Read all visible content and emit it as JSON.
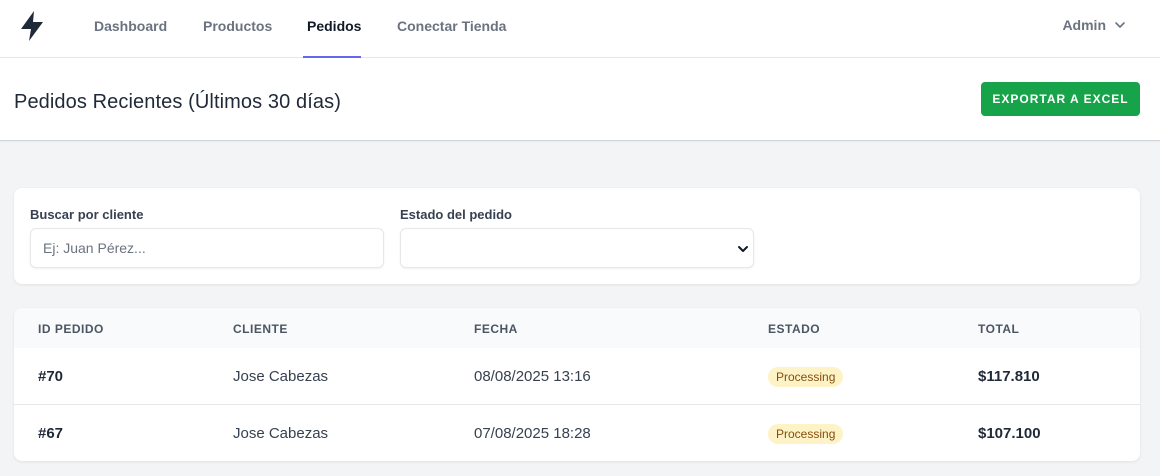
{
  "nav": {
    "logo_icon": "lightning-bolt-icon",
    "links": [
      {
        "label": "Dashboard"
      },
      {
        "label": "Productos"
      },
      {
        "label": "Pedidos"
      },
      {
        "label": "Conectar Tienda"
      }
    ],
    "active_link": "Pedidos",
    "user_label": "Admin",
    "user_icon": "chevron-down-icon"
  },
  "header": {
    "title": "Pedidos Recientes (Últimos 30 días)",
    "export_label": "EXPORTAR A EXCEL"
  },
  "filters": {
    "search_label": "Buscar por cliente",
    "search_placeholder": "Ej: Juan Pérez...",
    "search_value": "",
    "status_label": "Estado del pedido",
    "status_value": ""
  },
  "table": {
    "columns": [
      "ID PEDIDO",
      "CLIENTE",
      "FECHA",
      "ESTADO",
      "TOTAL"
    ],
    "rows": [
      {
        "id": "#70",
        "client": "Jose Cabezas",
        "date": "08/08/2025 13:16",
        "status": "Processing",
        "total": "$117.810"
      },
      {
        "id": "#67",
        "client": "Jose Cabezas",
        "date": "07/08/2025 18:28",
        "status": "Processing",
        "total": "$107.100"
      }
    ]
  },
  "colors": {
    "accent": "#6366f1",
    "export_button": "#16a34a",
    "status_badge_bg": "#fef3c7",
    "status_badge_text": "#854d0e"
  }
}
